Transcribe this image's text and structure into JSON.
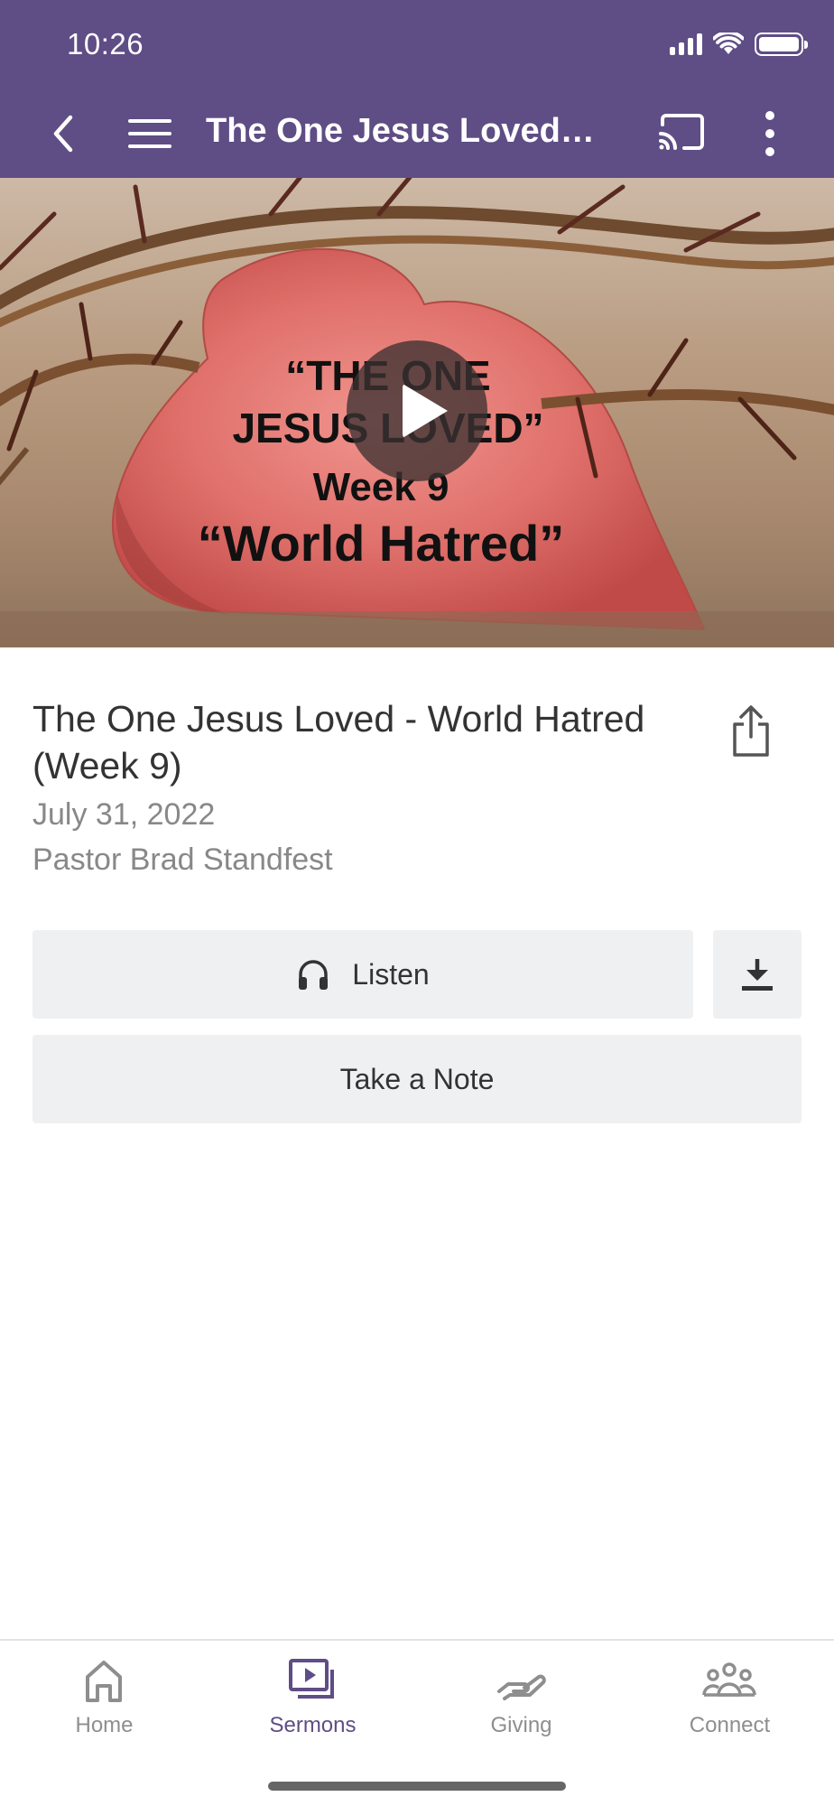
{
  "status_bar": {
    "time": "10:26"
  },
  "nav": {
    "title": "The One Jesus Loved - World Hatred (Week 9)"
  },
  "hero": {
    "line1": "“THE ONE",
    "line2": "JESUS LOVED”",
    "line3": "Week 9",
    "line4": "“World Hatred”"
  },
  "sermon": {
    "title": "The One Jesus Loved - World Hatred (Week 9)",
    "date": "July 31, 2022",
    "speaker": "Pastor Brad Standfest"
  },
  "actions": {
    "listen_label": "Listen",
    "note_label": "Take a Note"
  },
  "tabs": [
    {
      "label": "Home",
      "icon": "home-icon",
      "active": false
    },
    {
      "label": "Sermons",
      "icon": "sermons-icon",
      "active": true
    },
    {
      "label": "Giving",
      "icon": "giving-icon",
      "active": false
    },
    {
      "label": "Connect",
      "icon": "connect-icon",
      "active": false
    }
  ],
  "colors": {
    "brand": "#5f4d85",
    "button_bg": "#eff0f1",
    "muted_text": "#888888"
  }
}
